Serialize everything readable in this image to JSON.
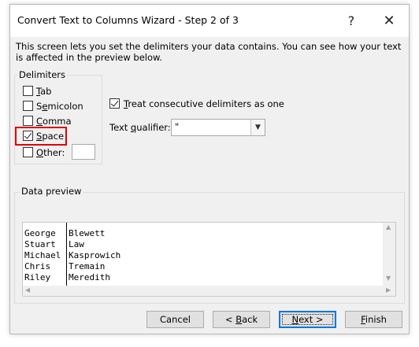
{
  "window": {
    "title": "Convert Text to Columns Wizard - Step 2 of 3"
  },
  "titlebar": {
    "help_glyph": "?",
    "close_glyph": "✕"
  },
  "description": "This screen lets you set the delimiters your data contains.  You can see how your text is affected in the preview below.",
  "delimiters": {
    "legend": "Delimiters",
    "items": [
      {
        "label": "Tab",
        "mnemonic_index": 0,
        "checked": false
      },
      {
        "label": "Semicolon",
        "mnemonic_index": 1,
        "checked": false
      },
      {
        "label": "Comma",
        "mnemonic_index": 0,
        "checked": false
      },
      {
        "label": "Space",
        "mnemonic_index": 0,
        "checked": true,
        "highlighted": true
      },
      {
        "label": "Other:",
        "mnemonic_index": 0,
        "checked": false
      }
    ],
    "other_value": ""
  },
  "options": {
    "consecutive_label": "Treat consecutive delimiters as one",
    "consecutive_checked": true,
    "qualifier_label": "Text qualifier:",
    "qualifier_value": "\""
  },
  "preview": {
    "legend": "Data preview",
    "rows": [
      [
        "George",
        "Blewett"
      ],
      [
        "Stuart",
        "Law"
      ],
      [
        "Michael",
        "Kasprowich"
      ],
      [
        "Chris",
        "Tremain"
      ],
      [
        "Riley",
        "Meredith"
      ]
    ]
  },
  "buttons": {
    "cancel": "Cancel",
    "back": "< Back",
    "next": "Next >",
    "finish": "Finish"
  },
  "colors": {
    "highlight": "#e00000",
    "focus": "#0078d7"
  }
}
